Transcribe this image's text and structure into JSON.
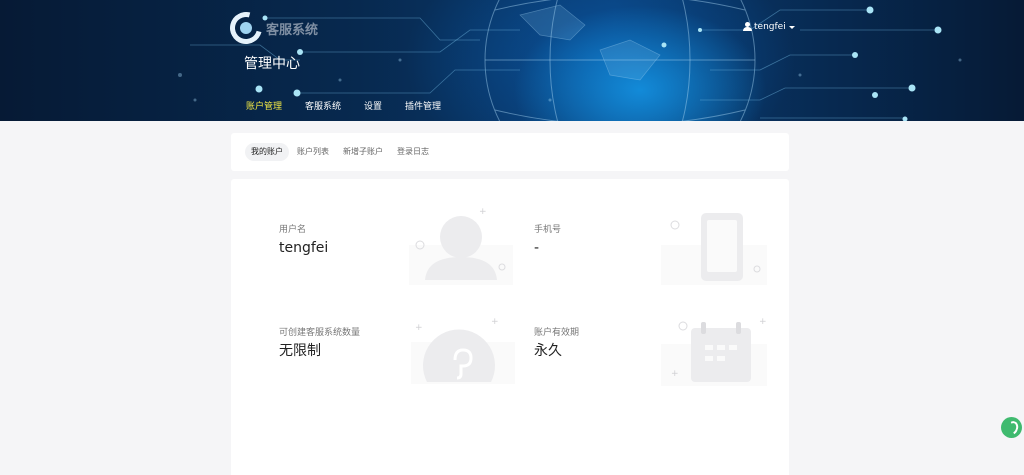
{
  "header": {
    "logo_text": "客服系统",
    "title": "管理中心",
    "user": {
      "name": "tengfei"
    },
    "nav": [
      {
        "label": "账户管理",
        "active": true
      },
      {
        "label": "客服系统",
        "active": false
      },
      {
        "label": "设置",
        "active": false
      },
      {
        "label": "插件管理",
        "active": false
      }
    ]
  },
  "sub_tabs": [
    {
      "label": "我的账户",
      "active": true
    },
    {
      "label": "账户列表",
      "active": false
    },
    {
      "label": "新增子账户",
      "active": false
    },
    {
      "label": "登录日志",
      "active": false
    }
  ],
  "account": {
    "username_label": "用户名",
    "username_value": "tengfei",
    "phone_label": "手机号",
    "phone_value": "-",
    "quota_label": "可创建客服系统数量",
    "quota_value": "无限制",
    "validity_label": "账户有效期",
    "validity_value": "永久"
  },
  "colors": {
    "active_nav": "#f4ea45",
    "float_widget": "#3fba6f"
  },
  "icons": [
    "user-icon",
    "caret-down-icon",
    "person-illustration-icon",
    "phone-illustration-icon",
    "link-illustration-icon",
    "calendar-illustration-icon",
    "chat-widget-icon"
  ]
}
